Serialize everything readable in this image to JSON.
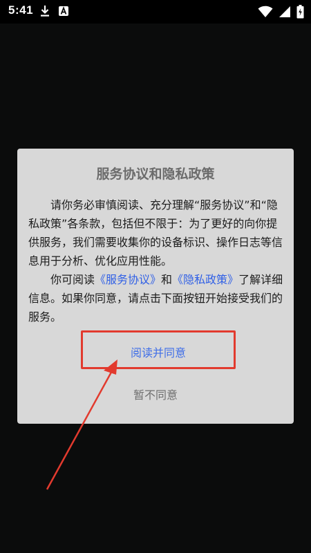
{
  "status_bar": {
    "time": "5:41",
    "icons": [
      "download-icon",
      "text-a-icon",
      "wifi-icon",
      "signal-icon",
      "battery-icon"
    ]
  },
  "dialog": {
    "title": "服务协议和隐私政策",
    "para1": "请你务必审慎阅读、充分理解“服务协议”和“隐私政策”各条款，包括但不限于：为了更好的向你提供服务，我们需要收集你的设备标识、操作日志等信息用于分析、优化应用性能。",
    "para2_prefix": "你可阅读",
    "service_link": "《服务协议》",
    "para2_and": "和",
    "privacy_link": "《隐私政策》",
    "para2_suffix": "了解详细信息。如果你同意，请点击下面按钮开始接受我们的服务。",
    "agree_label": "阅读并同意",
    "disagree_label": "暂不同意"
  },
  "colors": {
    "link": "#2f5fe6",
    "highlight": "#e23a2e",
    "dialog_bg": "#d8d8d8"
  }
}
